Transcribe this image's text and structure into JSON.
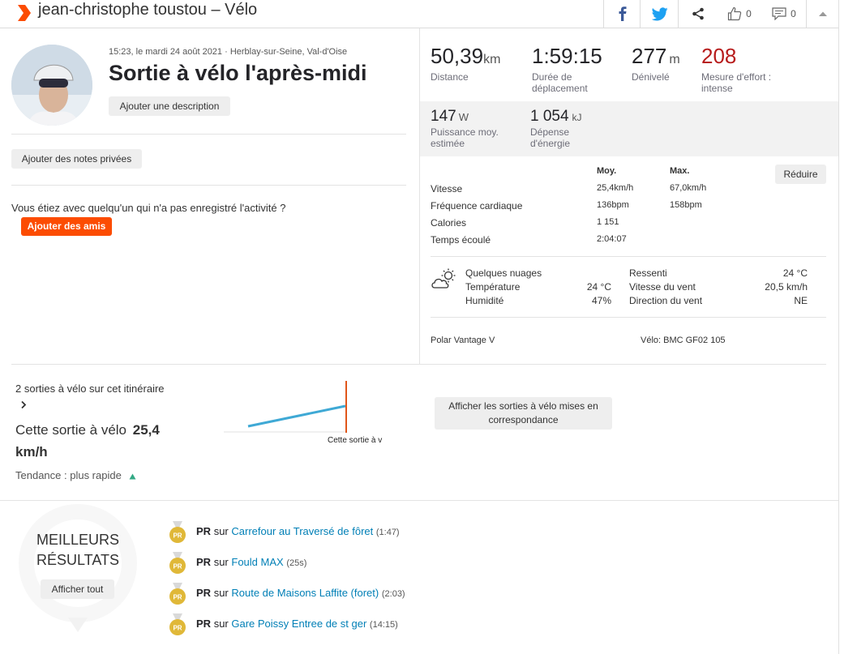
{
  "header": {
    "title": "jean-christophe toustou – Vélo",
    "kudos_count": "0",
    "comments_count": "0"
  },
  "activity": {
    "datetime_location": "15:23, le mardi 24 août 2021 · Herblay-sur-Seine, Val-d'Oise",
    "title": "Sortie à vélo l'après-midi",
    "add_description": "Ajouter une description",
    "add_private_notes": "Ajouter des notes privées",
    "with_someone_text": "Vous étiez avec quelqu'un qui n'a pas enregistré l'activité ?",
    "add_friends": "Ajouter des amis"
  },
  "stats": {
    "distance_value": "50,39",
    "distance_unit": "km",
    "distance_label": "Distance",
    "moving_time_value": "1:59:15",
    "moving_time_label_1": "Durée de",
    "moving_time_label_2": "déplacement",
    "elevation_value": "277",
    "elevation_unit": "m",
    "elevation_label": "Dénivelé",
    "effort_value": "208",
    "effort_label_1": "Mesure d'effort :",
    "effort_label_2": "intense",
    "power_value": "147",
    "power_unit": "W",
    "power_label_1": "Puissance moy.",
    "power_label_2": "estimée",
    "energy_value": "1 054",
    "energy_unit": "kJ",
    "energy_label_1": "Dépense",
    "energy_label_2": "d'énergie"
  },
  "details": {
    "col_avg": "Moy.",
    "col_max": "Max.",
    "reduce_button": "Réduire",
    "rows": [
      {
        "label": "Vitesse",
        "avg": "25,4km/h",
        "max": "67,0km/h"
      },
      {
        "label": "Fréquence cardiaque",
        "avg": "136bpm",
        "max": "158bpm"
      },
      {
        "label": "Calories",
        "avg": "1 151",
        "max": ""
      },
      {
        "label": "Temps écoulé",
        "avg": "2:04:07",
        "max": ""
      }
    ]
  },
  "weather": {
    "icon": "partly-cloudy-icon",
    "condition": "Quelques nuages",
    "temp_label": "Température",
    "temp_value": "24 °C",
    "humidity_label": "Humidité",
    "humidity_value": "47%",
    "feels_label": "Ressenti",
    "feels_value": "24 °C",
    "wind_speed_label": "Vitesse du vent",
    "wind_speed_value": "20,5 km/h",
    "wind_dir_label": "Direction du vent",
    "wind_dir_value": "NE"
  },
  "gear": {
    "device": "Polar Vantage V",
    "bike": "Vélo: BMC GF02 105"
  },
  "matched": {
    "rides_count_text": "2 sorties à vélo sur cet itinéraire",
    "this_ride_prefix": "Cette sortie à vélo",
    "this_ride_value": "25,4",
    "this_ride_unit": "km/h",
    "trend_text": "Tendance : plus rapide",
    "chart_label": "Cette sortie à v",
    "show_button": "Afficher les sorties à vélo mises en correspondance",
    "line_color": "#3fa9d5",
    "marker_color": "#e0561a"
  },
  "best_results": {
    "title_1": "MEILLEURS",
    "title_2": "RÉSULTATS",
    "show_all": "Afficher tout",
    "items": [
      {
        "badge": "PR",
        "pr": "PR",
        "sur": "sur",
        "segment": "Carrefour au Traversé de fôret",
        "time": "(1:47)"
      },
      {
        "badge": "PR",
        "pr": "PR",
        "sur": "sur",
        "segment": "Fould MAX",
        "time": "(25s)"
      },
      {
        "badge": "PR",
        "pr": "PR",
        "sur": "sur",
        "segment": "Route de Maisons Laffite (foret)",
        "time": "(2:03)"
      },
      {
        "badge": "PR",
        "pr": "PR",
        "sur": "sur",
        "segment": "Gare Poissy Entree de st ger",
        "time": "(14:15)"
      }
    ]
  },
  "colors": {
    "accent": "#fc4c02",
    "effort_red": "#b71c1c",
    "link": "#007fb6",
    "pr_gold": "#e0b838"
  }
}
